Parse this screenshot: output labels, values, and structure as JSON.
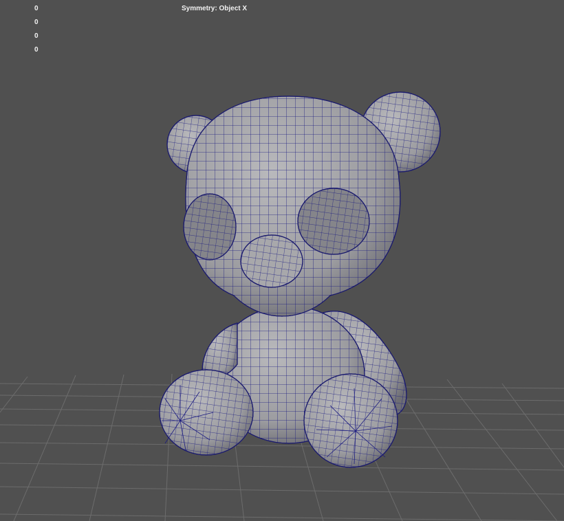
{
  "hud": {
    "stats": [
      "0",
      "0",
      "0",
      "0"
    ],
    "symmetry": "Symmetry: Object X"
  },
  "viewport": {
    "background": "#505050",
    "grid_color": "#6a6a6a",
    "mesh_fill": "#a3a3a6",
    "wire_color": "#15157a"
  }
}
